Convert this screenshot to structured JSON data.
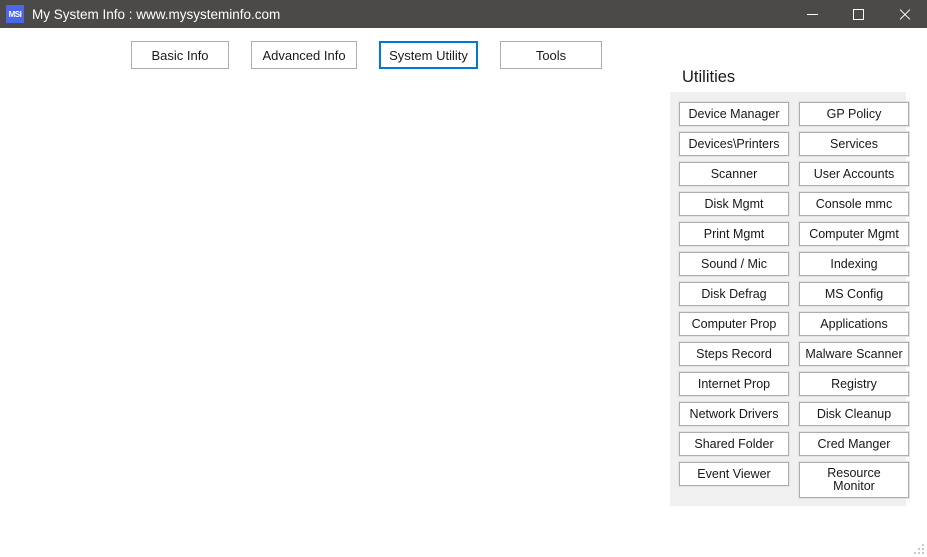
{
  "window": {
    "icon_label": "MSI",
    "icon_name": "app-icon",
    "title": "My System Info : www.mysysteminfo.com",
    "controls": [
      {
        "name": "minimize-button",
        "label": "Minimize"
      },
      {
        "name": "maximize-button",
        "label": "Maximize"
      },
      {
        "name": "close-button",
        "label": "Close"
      }
    ]
  },
  "colors": {
    "titlebar_bg": "#4c4a48",
    "accent": "#0078d7",
    "panel_bg": "#f0f0f0",
    "button_bg": "#ffffff",
    "button_border": "#adadad",
    "app_icon_bg": "#4b67e8"
  },
  "tabs": [
    {
      "label": "Basic Info",
      "selected": false
    },
    {
      "label": "Advanced Info",
      "selected": false
    },
    {
      "label": "System Utility",
      "selected": true
    },
    {
      "label": "Tools",
      "selected": false
    }
  ],
  "utilities": {
    "heading": "Utilities",
    "buttons": [
      {
        "label": "Device Manager",
        "column": "left"
      },
      {
        "label": "GP Policy",
        "column": "right"
      },
      {
        "label": "Devices\\Printers",
        "column": "left"
      },
      {
        "label": "Services",
        "column": "right"
      },
      {
        "label": "Scanner",
        "column": "left"
      },
      {
        "label": "User Accounts",
        "column": "right"
      },
      {
        "label": "Disk Mgmt",
        "column": "left"
      },
      {
        "label": "Console mmc",
        "column": "right"
      },
      {
        "label": "Print Mgmt",
        "column": "left"
      },
      {
        "label": "Computer Mgmt",
        "column": "right"
      },
      {
        "label": "Sound / Mic",
        "column": "left"
      },
      {
        "label": "Indexing",
        "column": "right"
      },
      {
        "label": "Disk Defrag",
        "column": "left"
      },
      {
        "label": "MS Config",
        "column": "right"
      },
      {
        "label": "Computer Prop",
        "column": "left"
      },
      {
        "label": "Applications",
        "column": "right"
      },
      {
        "label": "Steps Record",
        "column": "left"
      },
      {
        "label": "Malware Scanner",
        "column": "right"
      },
      {
        "label": "Internet Prop",
        "column": "left"
      },
      {
        "label": "Registry",
        "column": "right"
      },
      {
        "label": "Network Drivers",
        "column": "left"
      },
      {
        "label": "Disk Cleanup",
        "column": "right"
      },
      {
        "label": "Shared Folder",
        "column": "left"
      },
      {
        "label": "Cred Manger",
        "column": "right"
      },
      {
        "label": "Event Viewer",
        "column": "left"
      },
      {
        "label": "Resource\nMonitor",
        "column": "right",
        "tall": true
      }
    ]
  },
  "resize_grip": {
    "name": "resize-grip"
  }
}
